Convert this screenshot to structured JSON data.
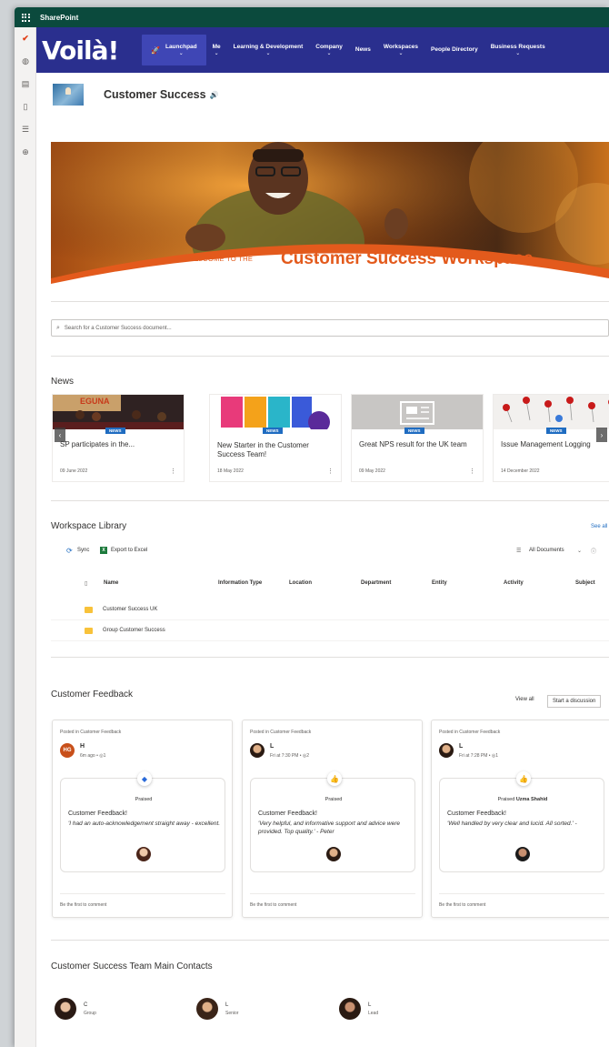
{
  "suite": {
    "brand": "SharePoint"
  },
  "hubnav": {
    "logo": "Voilà!",
    "items": [
      {
        "label": "Launchpad",
        "chevron": "⌄"
      },
      {
        "label": "Me",
        "chevron": "⌄"
      },
      {
        "label": "Learning & Development",
        "chevron": "⌄"
      },
      {
        "label": "Company",
        "chevron": "⌄"
      },
      {
        "label": "News",
        "chevron": ""
      },
      {
        "label": "Workspaces",
        "chevron": "⌄"
      },
      {
        "label": "People Directory",
        "chevron": ""
      },
      {
        "label": "Business Requests",
        "chevron": "⌄"
      }
    ]
  },
  "site": {
    "title": "Customer Success",
    "speaker": "🔊"
  },
  "hero": {
    "welcome": "WELCOME TO THE",
    "title": "Customer Success Workspace"
  },
  "search": {
    "placeholder": "Search for a Customer Success document..."
  },
  "news": {
    "title": "News",
    "badge": "NEWS",
    "items": [
      {
        "title": "SP participates in the...",
        "date": "09 June 2022",
        "image": "stage-event",
        "image_text": "EGUNA"
      },
      {
        "title": "New Starter in the Customer Success Team!",
        "date": "18 May 2022",
        "image": "color-blocks"
      },
      {
        "title": "Great NPS result for the UK team",
        "date": "09 May 2022",
        "image": "newspaper-placeholder"
      },
      {
        "title": "Issue Management Logging",
        "date": "14 December 2022",
        "image": "red-pins"
      }
    ]
  },
  "library": {
    "title": "Workspace Library",
    "see_all": "See all",
    "sync": "Sync",
    "export": "Export to Excel",
    "view": "All Documents",
    "columns": [
      "Name",
      "Information Type",
      "Location",
      "Department",
      "Entity",
      "Activity",
      "Subject"
    ],
    "rows": [
      "Customer Success UK",
      "Group Customer Success"
    ]
  },
  "feedback": {
    "title": "Customer Feedback",
    "view_all": "View all",
    "start": "Start a discussion",
    "posted_in": "Posted in Customer Feedback",
    "praised_label": "Praised",
    "comment_prompt": "Be the first to comment",
    "posts": [
      {
        "initials": "HG",
        "user": "H",
        "meta": "6m ago  •  ◎1",
        "praised": "Praised",
        "praised_name": "",
        "title": "Customer Feedback!",
        "quote": "'I had an auto-acknowledgement straight away - excellent.",
        "icon": "diamond-icon"
      },
      {
        "initials": "",
        "user": "L",
        "meta": "Fri at 7:30 PM  •  ◎2",
        "praised": "Praised",
        "praised_name": "",
        "title": "Customer Feedback!",
        "quote": "'Very helpful, and informative support and advice were provided. Top quality.' - Peter",
        "icon": "thumbs-up-icon"
      },
      {
        "initials": "",
        "user": "L",
        "meta": "Fri at 7:28 PM  •  ◎1",
        "praised": "Praised",
        "praised_name": "Uzma Shahid",
        "title": "Customer Feedback!",
        "quote": "'Well handled by              very clear and lucid. All sorted.' -",
        "icon": "thumbs-up-icon"
      }
    ]
  },
  "contacts": {
    "title": "Customer Success Team Main Contacts",
    "items": [
      {
        "name": "C",
        "role": "Group"
      },
      {
        "name": "L",
        "role": "Senior"
      },
      {
        "name": "L",
        "role": "Lead"
      }
    ]
  },
  "colors": {
    "suite_bar": "#0b4a3d",
    "hub_nav": "#2a2f8e",
    "accent": "#e35a1c",
    "news_badge": "#1f6cc1"
  }
}
